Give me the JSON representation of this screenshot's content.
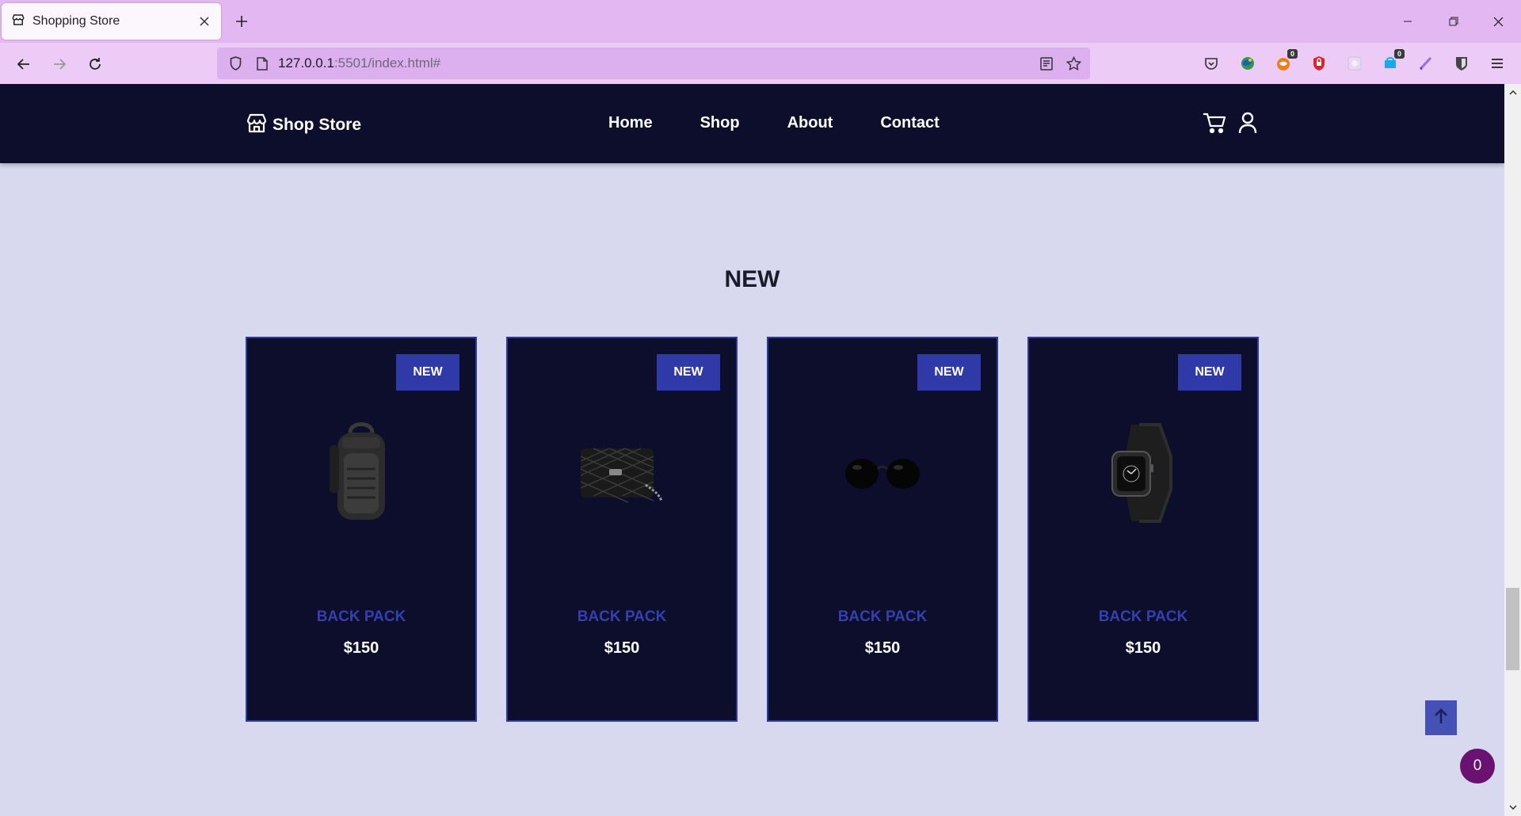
{
  "browser": {
    "tab_title": "Shopping Store",
    "url_host": "127.0.0.1",
    "url_rest": ":5501/index.html#",
    "extensions": [
      {
        "name": "pocket-icon",
        "badge": ""
      },
      {
        "name": "globe-extension-icon",
        "badge": ""
      },
      {
        "name": "fox-extension-icon",
        "badge": "0"
      },
      {
        "name": "shield-extension-icon",
        "badge": ""
      },
      {
        "name": "faded-extension-icon",
        "badge": ""
      },
      {
        "name": "blue-extension-icon",
        "badge": "0"
      },
      {
        "name": "pen-extension-icon",
        "badge": ""
      },
      {
        "name": "bitwarden-icon",
        "badge": ""
      }
    ]
  },
  "header": {
    "logo_text": "Shop Store",
    "menu": [
      "Home",
      "Shop",
      "About",
      "Contact"
    ]
  },
  "section": {
    "title": "NEW"
  },
  "products": [
    {
      "badge": "NEW",
      "name": "BACK PACK",
      "price": "$150",
      "icon": "backpack-image"
    },
    {
      "badge": "NEW",
      "name": "BACK PACK",
      "price": "$150",
      "icon": "handbag-image"
    },
    {
      "badge": "NEW",
      "name": "BACK PACK",
      "price": "$150",
      "icon": "sunglasses-image"
    },
    {
      "badge": "NEW",
      "name": "BACK PACK",
      "price": "$150",
      "icon": "smartwatch-image"
    }
  ],
  "cart_count": "0",
  "colors": {
    "page_bg": "#d8d9ef",
    "header_bg": "#0c0e2c",
    "accent": "#2f3aa8",
    "cart_bubble": "#6a1271"
  }
}
